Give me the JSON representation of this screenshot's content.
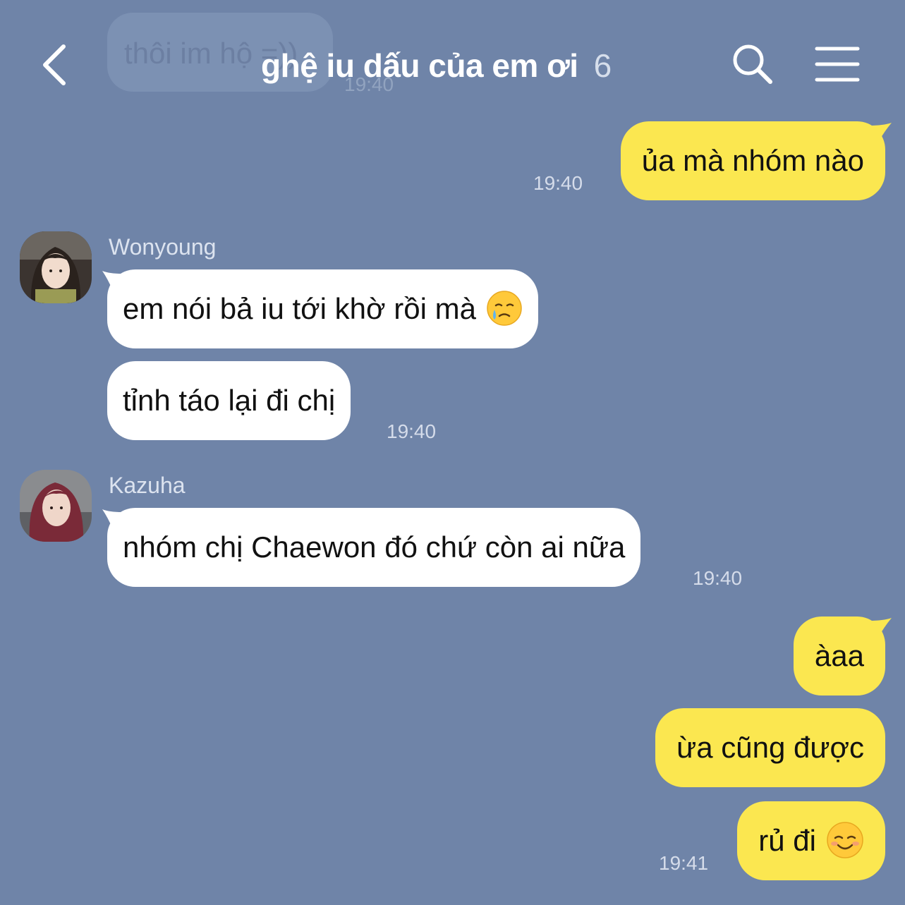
{
  "header": {
    "title": "ghệ iu dấu của em ơi",
    "member_count": "6",
    "back_icon": "chevron-left-icon",
    "search_icon": "search-icon",
    "menu_icon": "hamburger-menu-icon"
  },
  "faded_message": {
    "text": "thôi im hộ =))",
    "time": "19:40"
  },
  "messages": [
    {
      "from": "me",
      "text": "ủa mà nhóm nào",
      "time": "19:40"
    },
    {
      "from": "Wonyoung",
      "text": "em nói bả iu tới khờ rồi mà",
      "emoji": "crying-smile-emoji"
    },
    {
      "from": "Wonyoung",
      "text": "tỉnh táo lại đi chị",
      "time": "19:40"
    },
    {
      "from": "Kazuha",
      "text": "nhóm chị Chaewon đó chứ còn ai nữa",
      "time": "19:40"
    },
    {
      "from": "me",
      "text": "àaa"
    },
    {
      "from": "me",
      "text": "ừa cũng được"
    },
    {
      "from": "me",
      "text": "rủ đi",
      "emoji": "smiling-blush-emoji",
      "time": "19:41"
    }
  ],
  "senders": {
    "wonyoung": "Wonyoung",
    "kazuha": "Kazuha"
  },
  "colors": {
    "background": "#6f84a8",
    "my_bubble": "#fbe750",
    "their_bubble": "#ffffff"
  }
}
